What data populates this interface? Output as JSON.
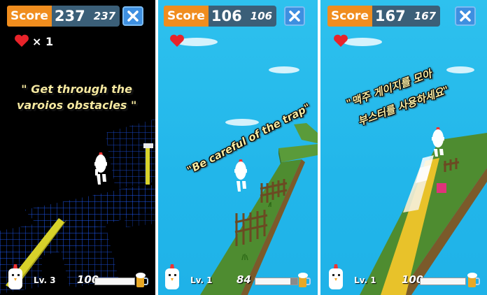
{
  "panels": [
    {
      "score_label": "Score",
      "score": "237",
      "best_score": "237",
      "lives": "× 1",
      "caption_lines": [
        "\" Get through the",
        "varoios obstacles \""
      ],
      "level": "Lv. 3",
      "gauge_value": "100",
      "gauge_fill_fraction": 1.0,
      "background": "#000000"
    },
    {
      "score_label": "Score",
      "score": "106",
      "best_score": "106",
      "caption_lines": [
        "\"Be careful of the trap\""
      ],
      "level": "Lv. 1",
      "gauge_value": "84",
      "gauge_fill_fraction": 0.84,
      "background": "#22b6ea"
    },
    {
      "score_label": "Score",
      "score": "167",
      "best_score": "167",
      "caption_lines": [
        "\"맥주 게이지를 모아",
        "부스터를 사용하세요\""
      ],
      "level": "Lv. 1",
      "gauge_value": "100",
      "gauge_fill_fraction": 1.0,
      "background": "#22b6ea"
    }
  ],
  "icons": {
    "close": "close-icon",
    "heart": "heart-icon",
    "avatar": "chicken-avatar-icon",
    "beer": "beer-mug-icon"
  },
  "colors": {
    "score_label_bg": "#f08d1e",
    "score_box_bg": "#3b5f78",
    "close_button_bg": "#3e8fe0",
    "heart": "#e8232a",
    "sky": "#22b6ea",
    "grass": "#4b8b2f",
    "wireframe": "#1f5cff",
    "boost_trail": "#e8c22a"
  }
}
